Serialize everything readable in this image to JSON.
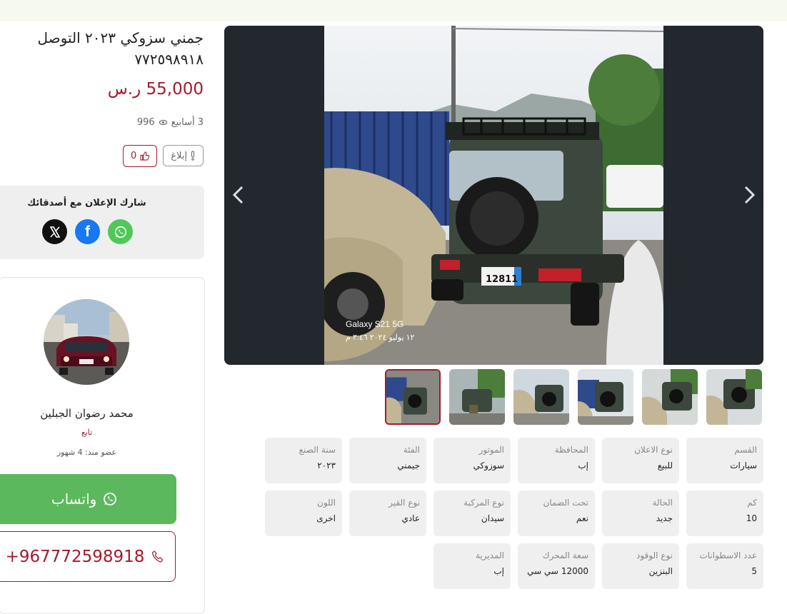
{
  "listing": {
    "title": "جمني سزوكي ٢٠٢٣ التوصل ٧٧٢٥٩٨٩١٨",
    "price": "55,000 ر.س",
    "age": "3 أسابيع",
    "views": "996",
    "report_label": "إبلاغ",
    "likes": "0"
  },
  "share": {
    "title": "شارك الإعلان مع أصدقائك",
    "icons": [
      "whatsapp-icon",
      "facebook-icon",
      "x-icon"
    ]
  },
  "seller": {
    "name": "محمد رضوان الجبلين",
    "follow": "تابع",
    "member_since": "عضو منذ: 4 شهور",
    "whatsapp_label": "واتساب",
    "phone": "+967772598918"
  },
  "photo": {
    "caption_device": "Galaxy S21 5G",
    "caption_date": "١٢ يوليو ٢٠٢٤ ٣:٤٦ م",
    "plate": "12811"
  },
  "details": [
    {
      "label": "القسم",
      "value": "سيارات"
    },
    {
      "label": "نوع الاعلان",
      "value": "للبيع"
    },
    {
      "label": "المحافظة",
      "value": "إب"
    },
    {
      "label": "الموتور",
      "value": "سوزوكي"
    },
    {
      "label": "الفئة",
      "value": "جيمني"
    },
    {
      "label": "سنة الصنع",
      "value": "٢٠٢٣"
    },
    {
      "label": "كم",
      "value": "10"
    },
    {
      "label": "الحالة",
      "value": "جديد"
    },
    {
      "label": "تحت الضمان",
      "value": "نعم"
    },
    {
      "label": "نوع المركبة",
      "value": "سيدان"
    },
    {
      "label": "نوع القير",
      "value": "عادي"
    },
    {
      "label": "اللون",
      "value": "اخرى"
    },
    {
      "label": "عدد الاسطوانات",
      "value": "5"
    },
    {
      "label": "نوع الوقود",
      "value": "البنزين"
    },
    {
      "label": "سعة المحرك",
      "value": "12000 سي سي"
    },
    {
      "label": "المديرية",
      "value": "إب"
    }
  ],
  "colors": {
    "accent": "#a01c2c",
    "whatsapp": "#5cb85c",
    "facebook": "#1877f2",
    "x": "#111111",
    "gallery_bg": "#23272e"
  }
}
